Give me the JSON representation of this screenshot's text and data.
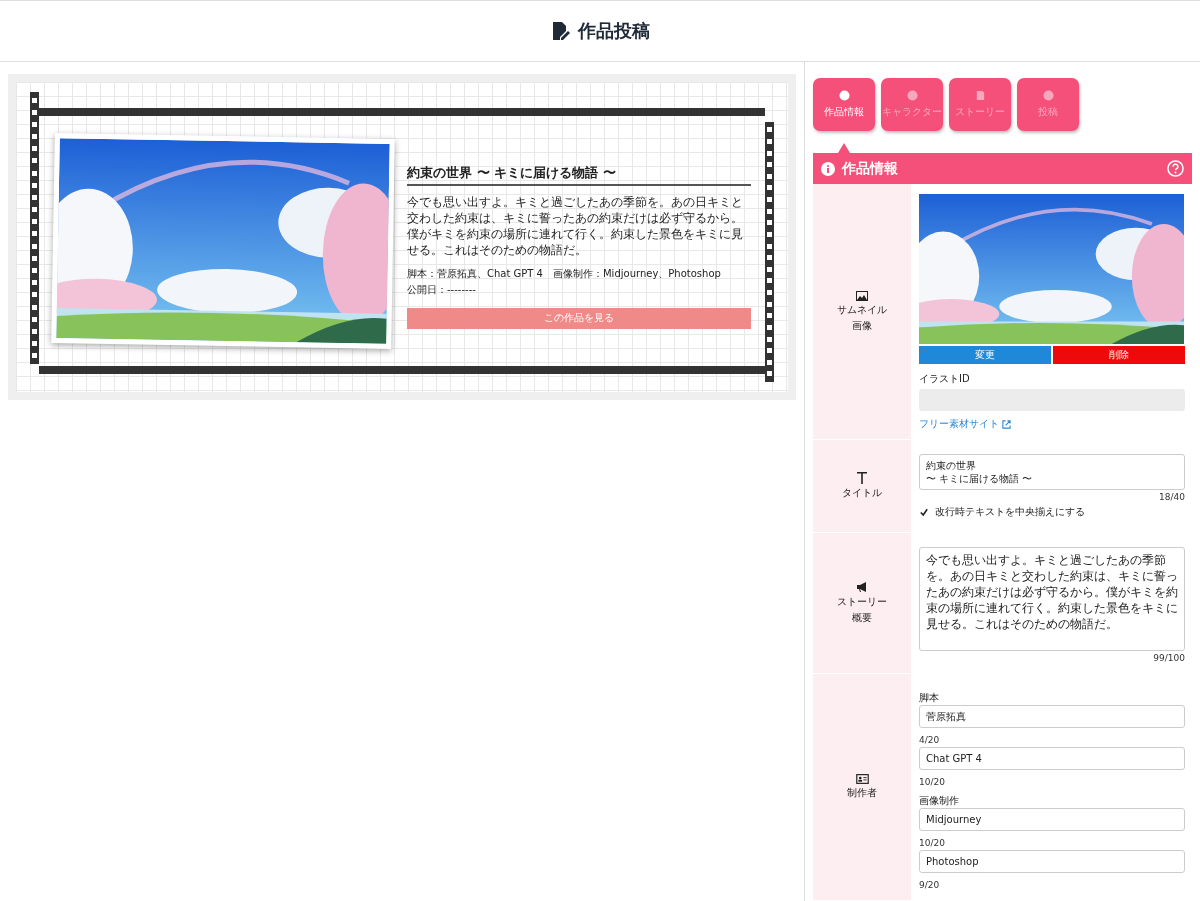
{
  "header": {
    "title": "作品投稿"
  },
  "preview": {
    "title": "約束の世界 〜 キミに届ける物語 〜",
    "summary": "今でも思い出すよ。キミと過ごしたあの季節を。あの日キミと交わした約束は、キミに誓ったあの約束だけは必ず守るから。僕がキミを約束の場所に連れて行く。約束した景色をキミに見せる。これはそのための物語だ。",
    "credits": "脚本：菅原拓真、Chat GPT 4　画像制作：Midjourney、Photoshop",
    "published": "公開日：--------",
    "view_button": "この作品を見る"
  },
  "tabs": [
    {
      "label": "作品情報",
      "selected": true
    },
    {
      "label": "キャラクター",
      "selected": false
    },
    {
      "label": "ストーリー",
      "selected": false
    },
    {
      "label": "投稿",
      "selected": false
    }
  ],
  "section": {
    "title": "作品情報"
  },
  "thumbnail": {
    "label": [
      "サムネイル",
      "画像"
    ],
    "change_button": "変更",
    "delete_button": "削除",
    "illust_id_label": "イラストID",
    "free_site_link": "フリー素材サイト"
  },
  "title_field": {
    "label": "タイトル",
    "lines": [
      "約束の世界",
      "〜 キミに届ける物語 〜"
    ],
    "counter": "18/40",
    "center_checkbox": {
      "label": "改行時テキストを中央揃えにする",
      "checked": true
    }
  },
  "story_field": {
    "label": [
      "ストーリー",
      "概要"
    ],
    "value": "今でも思い出すよ。キミと過ごしたあの季節を。あの日キミと交わした約束は、キミに誓ったあの約束だけは必ず守るから。僕がキミを約束の場所に連れて行く。約束した景色をキミに見せる。これはそのための物語だ。",
    "counter": "99/100"
  },
  "creators": {
    "label": "制作者",
    "groups": [
      {
        "label": "脚本",
        "fields": [
          {
            "value": "菅原拓真",
            "counter": "4/20"
          },
          {
            "value": "Chat GPT 4",
            "counter": "10/20"
          }
        ]
      },
      {
        "label": "画像制作",
        "fields": [
          {
            "value": "Midjourney",
            "counter": "10/20"
          },
          {
            "value": "Photoshop",
            "counter": "9/20"
          }
        ]
      }
    ]
  }
}
